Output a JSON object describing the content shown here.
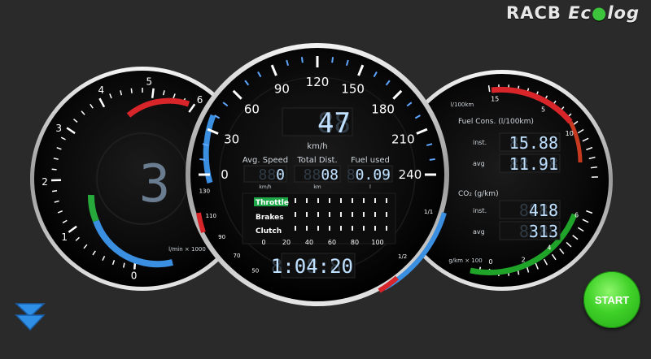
{
  "brand": {
    "racb": "RACB",
    "eco_prefix": "Ec",
    "eco_suffix": "log"
  },
  "rpm_gauge": {
    "ticks": [
      "0",
      "1",
      "2",
      "3",
      "4",
      "5",
      "6"
    ],
    "unit": "l/min × 1000",
    "gear": "3"
  },
  "speed_gauge": {
    "ticks": [
      "0",
      "30",
      "60",
      "90",
      "120",
      "150",
      "180",
      "210",
      "240"
    ],
    "speed": "47",
    "speed_ghost": "88",
    "unit": "km/h",
    "avg_speed_label": "Avg. Speed",
    "avg_speed": "0",
    "avg_speed_unit": "km/h",
    "total_dist_label": "Total Dist.",
    "total_dist": "08",
    "total_dist_unit": "km",
    "fuel_used_label": "Fuel used",
    "fuel_used": "0.09",
    "fuel_used_unit": "l",
    "throttle_label": "Throttle",
    "brakes_label": "Brakes",
    "clutch_label": "Clutch",
    "pedal_scale": [
      "0",
      "20",
      "40",
      "60",
      "80",
      "100"
    ],
    "clock": "1:04:20",
    "temp_ticks": [
      "130",
      "110",
      "90",
      "70",
      "50"
    ],
    "fuel_ticks": [
      "1/1",
      "1/2"
    ]
  },
  "fuel_gauge": {
    "top_unit": "l/100km",
    "fuel_cons_label": "Fuel Cons. (l/100km)",
    "inst_label": "inst.",
    "fuel_inst": "15.88",
    "avg_label": "avg",
    "fuel_avg": "11.91",
    "co2_label": "CO₂ (g/km)",
    "co2_inst": "418",
    "co2_avg": "313",
    "bottom_unit": "g/km × 100",
    "top_ticks": [
      "15",
      "5",
      "10"
    ],
    "bottom_ticks": [
      "6",
      "4",
      "2",
      "0"
    ]
  },
  "controls": {
    "start_label": "START"
  }
}
